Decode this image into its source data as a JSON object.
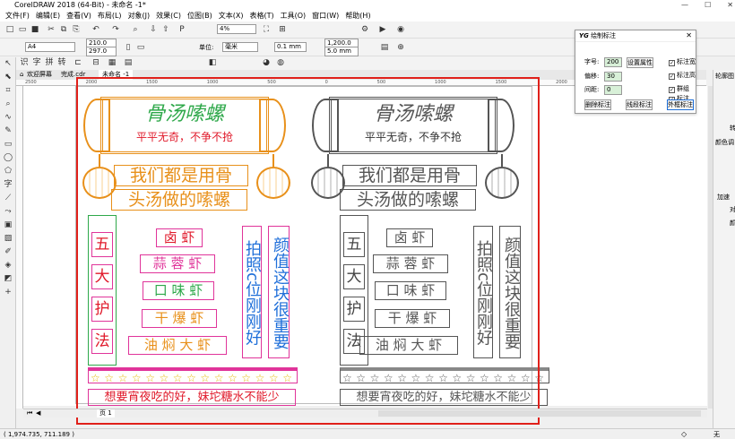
{
  "app": {
    "title": "CorelDRAW 2018 (64-Bit) - 未命名 -1*"
  },
  "menu": [
    "文件(F)",
    "编辑(E)",
    "查看(V)",
    "布局(L)",
    "对象(J)",
    "效果(C)",
    "位图(B)",
    "文本(X)",
    "表格(T)",
    "工具(O)",
    "窗口(W)",
    "帮助(H)"
  ],
  "toolbar": {
    "zoom": "4%"
  },
  "propbar": {
    "page_size": "A4",
    "width": "210.0 mm",
    "height": "297.0 mm",
    "unit_label": "单位:",
    "unit": "毫米",
    "nudge": "0.1 mm",
    "dup_x": "1,200.0 mm",
    "dup_y": "5.0 mm"
  },
  "tabs": {
    "welcome": "欢迎屏幕",
    "done": "完成.cdr",
    "untitled": "未命名 -1"
  },
  "ruler": {
    "marks": [
      "2500",
      "2000",
      "1500",
      "1000",
      "500",
      "0",
      "500",
      "1000",
      "1500",
      "2000",
      "2500",
      "3000"
    ]
  },
  "dialog": {
    "title": "绘制标注",
    "font_label": "字号:",
    "font_value": "200",
    "offset_label": "偏移:",
    "offset_value": "30",
    "spacing_label": "间距:",
    "spacing_value": "0",
    "set_props": "设置属性",
    "cb_width": "标注宽",
    "cb_height": "标注高",
    "cb_group": "群组",
    "cb_outer": "标注",
    "btn_delete": "删除标注",
    "btn_segment": "线段标注",
    "btn_outer": "外框标注"
  },
  "design": {
    "main_title": "骨汤嗦螺",
    "slogan": "平平无奇，不争不抢",
    "line1": "我们都是用骨",
    "line2": "头汤做的嗦螺",
    "vertical_chars": [
      "五",
      "大",
      "护",
      "法"
    ],
    "items": [
      "卤 虾",
      "蒜 蓉 虾",
      "口 味 虾",
      "干 爆 虾",
      "油 焖 大 虾"
    ],
    "col1": "拍照c位刚刚好",
    "col2": "颜值这块很重要",
    "footer": "想要宵夜吃的好，妹坨糖水不能少",
    "colors": {
      "orange": "#e8901a",
      "green": "#2ea84a",
      "red": "#e0192a",
      "pink": "#e0349a",
      "blue": "#1f6fd9",
      "gray": "#555555",
      "frame": "#e0201a"
    }
  },
  "rightpanel": {
    "items": [
      "轮廓图",
      "转",
      "颜色调",
      "加速",
      "对",
      "颜"
    ]
  },
  "status": {
    "coords": "( 1,974.735, 711.189 )",
    "page": "页 1",
    "fill": "无"
  }
}
